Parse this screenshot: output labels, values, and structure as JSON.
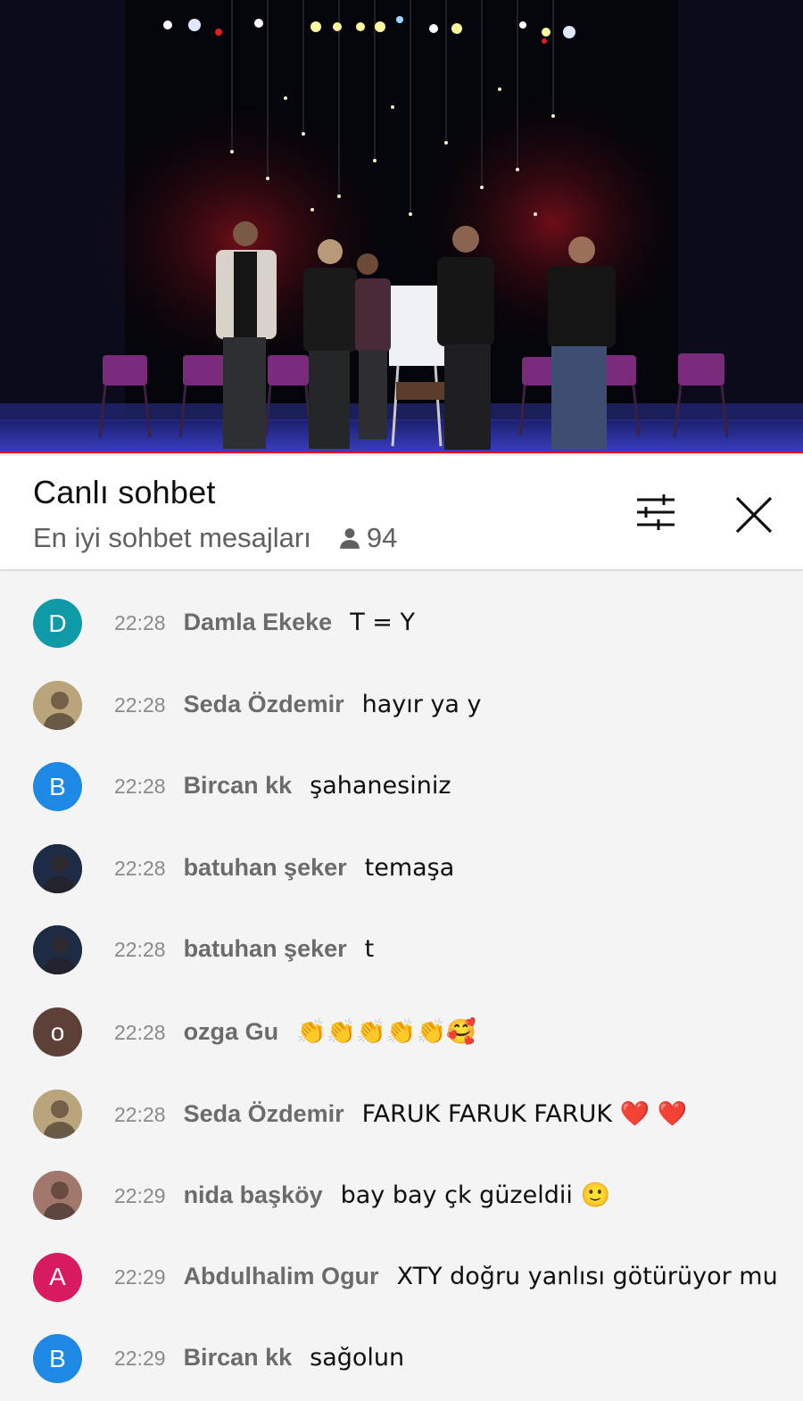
{
  "header": {
    "title": "Canlı sohbet",
    "mode_label": "En iyi sohbet mesajları",
    "viewer_count": "94",
    "icons": {
      "viewers": "person-icon",
      "filter": "sliders-icon",
      "close": "close-icon"
    }
  },
  "video": {
    "progress": 1.0,
    "accent_color": "#ee0000"
  },
  "messages": [
    {
      "time": "22:28",
      "author": "Damla Ekeke",
      "text": "T = Y",
      "avatar": {
        "kind": "letter",
        "letter": "D",
        "color": "#0e9aa7"
      }
    },
    {
      "time": "22:28",
      "author": "Seda Özdemir",
      "text": "hayır ya y",
      "avatar": {
        "kind": "photo",
        "color": "#b9a47c"
      }
    },
    {
      "time": "22:28",
      "author": "Bircan kk",
      "text": "şahanesiniz",
      "avatar": {
        "kind": "letter",
        "letter": "B",
        "color": "#1e88e5"
      }
    },
    {
      "time": "22:28",
      "author": "batuhan şeker",
      "text": "temaşa",
      "avatar": {
        "kind": "photo",
        "color": "#1d2b45"
      }
    },
    {
      "time": "22:28",
      "author": "batuhan şeker",
      "text": "t",
      "avatar": {
        "kind": "photo",
        "color": "#1d2b45"
      }
    },
    {
      "time": "22:28",
      "author": "ozga Gu",
      "text": "👏👏👏👏👏🥰",
      "avatar": {
        "kind": "letter",
        "letter": "o",
        "color": "#5d4037"
      }
    },
    {
      "time": "22:28",
      "author": "Seda Özdemir",
      "text": "FARUK FARUK FARUK ❤️ ❤️",
      "avatar": {
        "kind": "photo",
        "color": "#b9a47c"
      }
    },
    {
      "time": "22:29",
      "author": "nida başköy",
      "text": "bay bay çk güzeldii 🙂",
      "avatar": {
        "kind": "photo",
        "color": "#a1776c"
      }
    },
    {
      "time": "22:29",
      "author": "Abdulhalim Ogur",
      "text": "XTY doğru yanlısı götürüyor mu",
      "avatar": {
        "kind": "letter",
        "letter": "A",
        "color": "#d81b60"
      }
    },
    {
      "time": "22:29",
      "author": "Bircan kk",
      "text": "sağolun",
      "avatar": {
        "kind": "letter",
        "letter": "B",
        "color": "#1e88e5"
      }
    }
  ]
}
